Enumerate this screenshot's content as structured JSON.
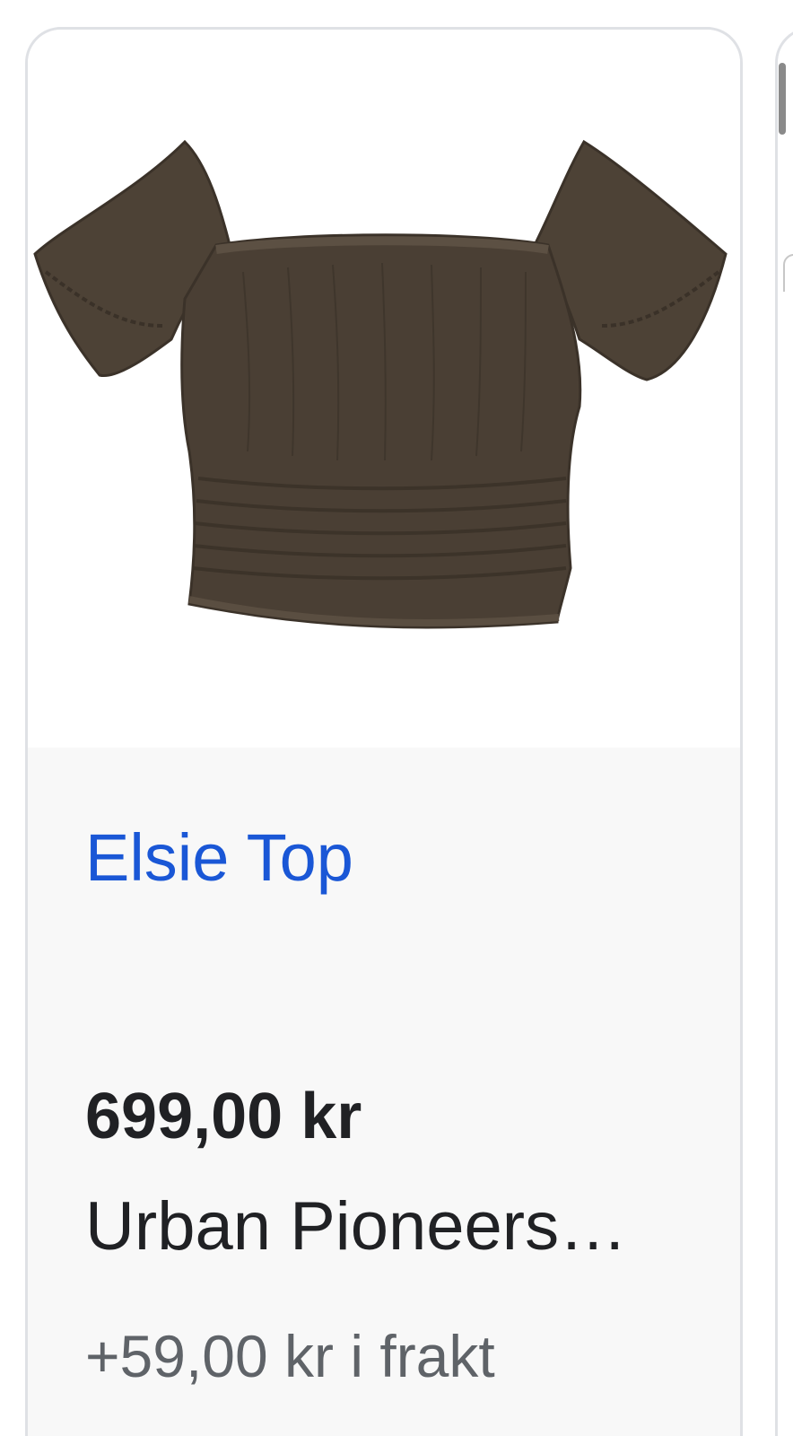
{
  "product": {
    "title": "Elsie Top",
    "price": "699,00 kr",
    "seller": "Urban Pioneers…",
    "shipping": "+59,00 kr i frakt",
    "image_description_icon": "product-image",
    "garment_color": "#4a3f34"
  },
  "colors": {
    "title_link": "#1a57d6",
    "card_border": "#dfe1e5",
    "card_body_bg": "#f8f8f8"
  }
}
